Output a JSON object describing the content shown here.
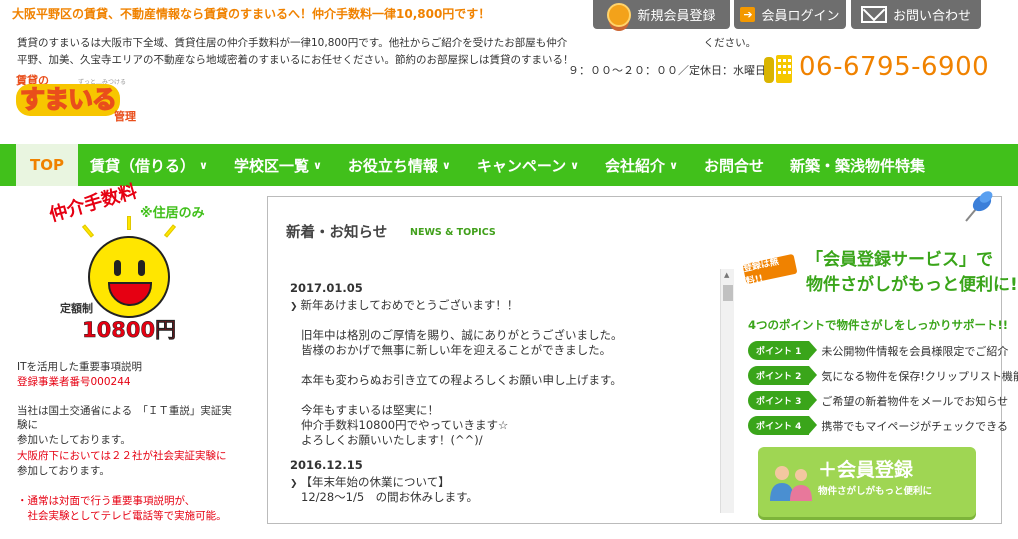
{
  "header": {
    "tagline": "大阪平野区の賃貸、不動産情報なら賃貸のすまいるへ！仲介手数料一律10,800円です！",
    "buttons": {
      "register": "新規会員登録",
      "login": "会員ログイン",
      "contact": "お問い合わせ"
    },
    "intro_line1": "賃貸のすまいるは大阪市下全域、賃貸住居の仲介手数料が一律10,800円です。他社からご紹介を受けたお部屋も仲介　　　　　　　　　　　　　ください。",
    "intro_line2": "平野、加美、久宝寺エリアの不動産なら地域密着のすまいるにお任せください。節約のお部屋探しは賃貸のすまいる！",
    "hours": "９：００〜２０：００／定休日：水曜日",
    "phone": "06-6795-6900",
    "logo": {
      "small": "賃貸の",
      "big": "すまいる",
      "suffix": "管理",
      "tagline": "ずっと…みつける"
    }
  },
  "nav": {
    "items": [
      {
        "label": "TOP",
        "chevron": ""
      },
      {
        "label": "賃貸（借りる）",
        "chevron": "∨"
      },
      {
        "label": "学校区一覧",
        "chevron": "∨"
      },
      {
        "label": "お役立ち情報",
        "chevron": "∨"
      },
      {
        "label": "キャンペーン",
        "chevron": "∨"
      },
      {
        "label": "会社紹介",
        "chevron": "∨"
      },
      {
        "label": "お問合せ",
        "chevron": ""
      },
      {
        "label": "新築・築浅物件特集",
        "chevron": ""
      }
    ]
  },
  "promo": {
    "fee_label": "仲介手数料",
    "residential_only": "※住居のみ",
    "fixed": "定額制",
    "amount": "10800円"
  },
  "left_text": {
    "it_title": "ITを活用した重要事項説明",
    "registration": "登録事業者番号000244",
    "p1": [
      "当社は国土交通省による　「ＩＴ重説」実証実",
      "験に",
      "参加いたしております。"
    ],
    "p2": [
      "大阪府下においては２２社が社会実証実験に"
    ],
    "p3": [
      "参加しております。"
    ],
    "p4": [
      "・通常は対面で行う重要事項説明が、",
      "　社会実験としてテレビ電話等で実施可能。"
    ]
  },
  "news": {
    "title": "新着・お知らせ",
    "subtitle": "NEWS & TOPICS",
    "entries": [
      {
        "date": "2017.01.05",
        "headline": "新年あけましておめでとうございます！！",
        "lines": [
          "",
          "旧年中は格別のご厚情を賜り、誠にありがとうございました。",
          "皆様のおかげで無事に新しい年を迎えることができました。",
          "",
          "本年も変わらぬお引き立ての程よろしくお願い申し上げます。",
          "",
          "今年もすまいるは堅実に！",
          "仲介手数料10800円でやっていきます☆",
          "よろしくお願いいたします！(^^)/"
        ]
      },
      {
        "date": "2016.12.15",
        "headline": "【年末年始の休業について】",
        "lines": [
          "12/28〜1/5　の間お休みします。"
        ]
      }
    ]
  },
  "member_ad": {
    "free_badge": "登録は無料!!",
    "heading1": "「会員登録サービス」で",
    "heading2": "物件さがしがもっと便利に!",
    "support": "4つのポイントで物件さがしをしっかりサポート!!",
    "points": [
      {
        "tag": "ポイント 1",
        "text": "未公開物件情報を会員様限定でご紹介"
      },
      {
        "tag": "ポイント 2",
        "text": "気になる物件を保存!クリップリスト機能"
      },
      {
        "tag": "ポイント 3",
        "text": "ご希望の新着物件をメールでお知らせ"
      },
      {
        "tag": "ポイント 4",
        "text": "携帯でもマイページがチェックできる"
      }
    ],
    "register_label": "＋会員登録",
    "register_sub": "物件さがしがもっと便利に"
  },
  "colors": {
    "accent_orange": "#f08200",
    "nav_green": "#41c01b",
    "red": "#e60012",
    "button_gray": "#6e6e6e"
  }
}
